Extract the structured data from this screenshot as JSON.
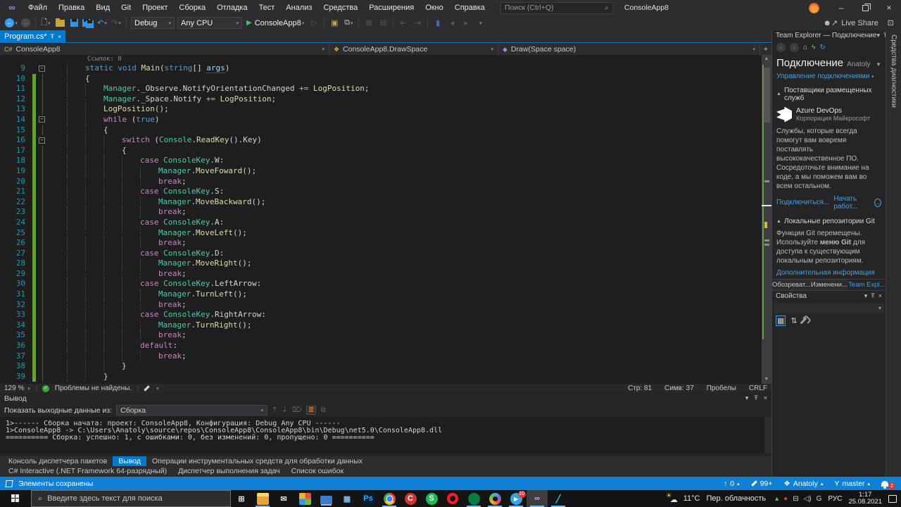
{
  "window": {
    "app_title": "ConsoleApp8",
    "search_placeholder": "Поиск (Ctrl+Q)",
    "live_share": "Live Share"
  },
  "menu": {
    "items": [
      "Файл",
      "Правка",
      "Вид",
      "Git",
      "Проект",
      "Сборка",
      "Отладка",
      "Тест",
      "Анализ",
      "Средства",
      "Расширения",
      "Окно",
      "Справка"
    ]
  },
  "toolbar": {
    "config": "Debug",
    "platform": "Any CPU",
    "start": "ConsoleApp8"
  },
  "editor": {
    "tab": "Program.cs*",
    "breadcrumb": {
      "project": "ConsoleApp8",
      "type": "ConsoleApp8.DrawSpace",
      "member": "Draw(Space space)"
    },
    "codelens": "Ссылок: 0",
    "zoom": "129 %",
    "problems": "Проблемы не найдены.",
    "status": {
      "line": "Стр: 81",
      "col": "Симв: 37",
      "spaces": "Пробелы",
      "eol": "CRLF"
    },
    "lines": [
      {
        "n": 9,
        "i": 2,
        "f": true,
        "m": false,
        "t": [
          [
            "k",
            "static"
          ],
          [
            "pl",
            " "
          ],
          [
            "k",
            "void"
          ],
          [
            "pl",
            " "
          ],
          [
            "me",
            "Main"
          ],
          [
            "pl",
            "("
          ],
          [
            "k",
            "string"
          ],
          [
            "pl",
            "[] "
          ],
          [
            "pa",
            "args"
          ],
          [
            "pl",
            ")"
          ]
        ]
      },
      {
        "n": 10,
        "i": 2,
        "f": false,
        "m": true,
        "t": [
          [
            "pl",
            "{"
          ]
        ]
      },
      {
        "n": 11,
        "i": 3,
        "f": false,
        "m": true,
        "t": [
          [
            "ty",
            "Manager"
          ],
          [
            "pl",
            "."
          ],
          [
            "pl",
            "_Observe"
          ],
          [
            "pl",
            "."
          ],
          [
            "pl",
            "NotifyOrientationChanged"
          ],
          [
            "op",
            " += "
          ],
          [
            "me",
            "LogPosition"
          ],
          [
            "pl",
            ";"
          ]
        ]
      },
      {
        "n": 12,
        "i": 3,
        "f": false,
        "m": true,
        "t": [
          [
            "ty",
            "Manager"
          ],
          [
            "pl",
            "."
          ],
          [
            "pl",
            "_Space"
          ],
          [
            "pl",
            "."
          ],
          [
            "pl",
            "Notify"
          ],
          [
            "op",
            " += "
          ],
          [
            "me",
            "LogPosition"
          ],
          [
            "pl",
            ";"
          ]
        ]
      },
      {
        "n": 13,
        "i": 3,
        "f": false,
        "m": true,
        "t": [
          [
            "me",
            "LogPosition"
          ],
          [
            "pl",
            "();"
          ]
        ]
      },
      {
        "n": 14,
        "i": 3,
        "f": true,
        "m": true,
        "t": [
          [
            "ct",
            "while"
          ],
          [
            "pl",
            " ("
          ],
          [
            "k",
            "true"
          ],
          [
            "pl",
            ")"
          ]
        ]
      },
      {
        "n": 15,
        "i": 3,
        "f": false,
        "m": true,
        "t": [
          [
            "pl",
            "{"
          ]
        ]
      },
      {
        "n": 16,
        "i": 4,
        "f": true,
        "m": true,
        "t": [
          [
            "ct",
            "switch"
          ],
          [
            "pl",
            " ("
          ],
          [
            "ty",
            "Console"
          ],
          [
            "pl",
            "."
          ],
          [
            "me",
            "ReadKey"
          ],
          [
            "pl",
            "()."
          ],
          [
            "pl",
            "Key"
          ],
          [
            "pl",
            ")"
          ]
        ]
      },
      {
        "n": 17,
        "i": 4,
        "f": false,
        "m": true,
        "t": [
          [
            "pl",
            "{"
          ]
        ]
      },
      {
        "n": 18,
        "i": 5,
        "f": false,
        "m": true,
        "t": [
          [
            "ct",
            "case"
          ],
          [
            "pl",
            " "
          ],
          [
            "ty",
            "ConsoleKey"
          ],
          [
            "pl",
            "."
          ],
          [
            "pl",
            "W"
          ],
          [
            "pl",
            ":"
          ]
        ]
      },
      {
        "n": 19,
        "i": 6,
        "f": false,
        "m": true,
        "t": [
          [
            "ty",
            "Manager"
          ],
          [
            "pl",
            "."
          ],
          [
            "me",
            "MoveFoward"
          ],
          [
            "pl",
            "();"
          ]
        ]
      },
      {
        "n": 20,
        "i": 6,
        "f": false,
        "m": true,
        "t": [
          [
            "ct",
            "break"
          ],
          [
            "pl",
            ";"
          ]
        ]
      },
      {
        "n": 21,
        "i": 5,
        "f": false,
        "m": true,
        "t": [
          [
            "ct",
            "case"
          ],
          [
            "pl",
            " "
          ],
          [
            "ty",
            "ConsoleKey"
          ],
          [
            "pl",
            "."
          ],
          [
            "pl",
            "S"
          ],
          [
            "pl",
            ":"
          ]
        ]
      },
      {
        "n": 22,
        "i": 6,
        "f": false,
        "m": true,
        "t": [
          [
            "ty",
            "Manager"
          ],
          [
            "pl",
            "."
          ],
          [
            "me",
            "MoveBackward"
          ],
          [
            "pl",
            "();"
          ]
        ]
      },
      {
        "n": 23,
        "i": 6,
        "f": false,
        "m": true,
        "t": [
          [
            "ct",
            "break"
          ],
          [
            "pl",
            ";"
          ]
        ]
      },
      {
        "n": 24,
        "i": 5,
        "f": false,
        "m": true,
        "t": [
          [
            "ct",
            "case"
          ],
          [
            "pl",
            " "
          ],
          [
            "ty",
            "ConsoleKey"
          ],
          [
            "pl",
            "."
          ],
          [
            "pl",
            "A"
          ],
          [
            "pl",
            ":"
          ]
        ]
      },
      {
        "n": 25,
        "i": 6,
        "f": false,
        "m": true,
        "t": [
          [
            "ty",
            "Manager"
          ],
          [
            "pl",
            "."
          ],
          [
            "me",
            "MoveLeft"
          ],
          [
            "pl",
            "();"
          ]
        ]
      },
      {
        "n": 26,
        "i": 6,
        "f": false,
        "m": true,
        "t": [
          [
            "ct",
            "break"
          ],
          [
            "pl",
            ";"
          ]
        ]
      },
      {
        "n": 27,
        "i": 5,
        "f": false,
        "m": true,
        "t": [
          [
            "ct",
            "case"
          ],
          [
            "pl",
            " "
          ],
          [
            "ty",
            "ConsoleKey"
          ],
          [
            "pl",
            "."
          ],
          [
            "pl",
            "D"
          ],
          [
            "pl",
            ":"
          ]
        ]
      },
      {
        "n": 28,
        "i": 6,
        "f": false,
        "m": true,
        "t": [
          [
            "ty",
            "Manager"
          ],
          [
            "pl",
            "."
          ],
          [
            "me",
            "MoveRight"
          ],
          [
            "pl",
            "();"
          ]
        ]
      },
      {
        "n": 29,
        "i": 6,
        "f": false,
        "m": true,
        "t": [
          [
            "ct",
            "break"
          ],
          [
            "pl",
            ";"
          ]
        ]
      },
      {
        "n": 30,
        "i": 5,
        "f": false,
        "m": true,
        "t": [
          [
            "ct",
            "case"
          ],
          [
            "pl",
            " "
          ],
          [
            "ty",
            "ConsoleKey"
          ],
          [
            "pl",
            "."
          ],
          [
            "pl",
            "LeftArrow"
          ],
          [
            "pl",
            ":"
          ]
        ]
      },
      {
        "n": 31,
        "i": 6,
        "f": false,
        "m": true,
        "t": [
          [
            "ty",
            "Manager"
          ],
          [
            "pl",
            "."
          ],
          [
            "me",
            "TurnLeft"
          ],
          [
            "pl",
            "();"
          ]
        ]
      },
      {
        "n": 32,
        "i": 6,
        "f": false,
        "m": true,
        "t": [
          [
            "ct",
            "break"
          ],
          [
            "pl",
            ";"
          ]
        ]
      },
      {
        "n": 33,
        "i": 5,
        "f": false,
        "m": true,
        "t": [
          [
            "ct",
            "case"
          ],
          [
            "pl",
            " "
          ],
          [
            "ty",
            "ConsoleKey"
          ],
          [
            "pl",
            "."
          ],
          [
            "pl",
            "RightArrow"
          ],
          [
            "pl",
            ":"
          ]
        ]
      },
      {
        "n": 34,
        "i": 6,
        "f": false,
        "m": true,
        "t": [
          [
            "ty",
            "Manager"
          ],
          [
            "pl",
            "."
          ],
          [
            "me",
            "TurnRight"
          ],
          [
            "pl",
            "();"
          ]
        ]
      },
      {
        "n": 35,
        "i": 6,
        "f": false,
        "m": true,
        "t": [
          [
            "ct",
            "break"
          ],
          [
            "pl",
            ";"
          ]
        ]
      },
      {
        "n": 36,
        "i": 5,
        "f": false,
        "m": true,
        "t": [
          [
            "ct",
            "default"
          ],
          [
            "pl",
            ":"
          ]
        ]
      },
      {
        "n": 37,
        "i": 6,
        "f": false,
        "m": true,
        "t": [
          [
            "ct",
            "break"
          ],
          [
            "pl",
            ";"
          ]
        ]
      },
      {
        "n": 38,
        "i": 4,
        "f": false,
        "m": true,
        "t": [
          [
            "pl",
            "}"
          ]
        ]
      },
      {
        "n": 39,
        "i": 3,
        "f": false,
        "m": true,
        "t": [
          [
            "pl",
            "}"
          ]
        ]
      }
    ]
  },
  "team_explorer": {
    "title": "Team Explorer — Подключение",
    "header": "Подключение",
    "user": "Anatoly",
    "manage_link": "Управление подключениями",
    "providers_section": "Поставщики размещенных служб",
    "azure": {
      "name": "Azure DevOps",
      "vendor": "Корпорация Майкрософт",
      "desc": "Службы, которые всегда помогут вам вовремя поставлять высококачественное ПО. Сосредоточьте внимание на коде, а мы поможем вам во всем остальном.",
      "connect_link": "Подключиться...",
      "start_link": "Начать работ..."
    },
    "git_section": "Локальные репозитории Git",
    "git_desc_1": "Функции Git перемещены. Используйте ",
    "git_desc_bold": "меню Git",
    "git_desc_2": " для доступа к существующим локальным репозиториям.",
    "git_link": "Дополнительная информация",
    "tabs": [
      {
        "label": "Обозреват...",
        "active": false
      },
      {
        "label": "Изменени...",
        "active": false
      },
      {
        "label": "Team Expl...",
        "active": true
      }
    ]
  },
  "properties_panel": {
    "title": "Свойства"
  },
  "right_strip": {
    "label": "Средства диагностики"
  },
  "output": {
    "title": "Вывод",
    "source_label": "Показать выходные данные из:",
    "source_value": "Сборка",
    "lines": [
      "1>------ Сборка начата: проект: ConsoleApp8, Конфигурация: Debug Any CPU ------",
      "1>ConsoleApp8 -> C:\\Users\\Anatoly\\source\\repos\\ConsoleApp8\\ConsoleApp8\\bin\\Debug\\net5.0\\ConsoleApp8.dll",
      "========== Сборка: успешно: 1, с ошибками: 0, без изменений: 0, пропущено: 0 =========="
    ]
  },
  "bottom_tabs": {
    "row1": [
      {
        "label": "Консоль диспетчера пакетов",
        "active": false
      },
      {
        "label": "Вывод",
        "active": true
      },
      {
        "label": "Операции инструментальных средств для обработки данных",
        "active": false
      }
    ],
    "row2": [
      {
        "label": "C# Interactive (.NET Framework 64-разрядный)",
        "active": false
      },
      {
        "label": "Диспетчер выполнения задач",
        "active": false
      },
      {
        "label": "Список ошибок",
        "active": false
      }
    ]
  },
  "status_bar": {
    "message": "Элементы сохранены",
    "pushes": "0",
    "edits": "99+",
    "user": "Anatoly",
    "branch": "master",
    "notifications": "2"
  },
  "taskbar": {
    "search_placeholder": "Введите здесь текст для поиска",
    "apps": [
      {
        "id": "task-view-button",
        "glyph": "⊞",
        "fg": "#e0e0e0",
        "shape": "none",
        "active": false
      },
      {
        "id": "file-explorer",
        "glyph": "",
        "shape": "folder",
        "active": true
      },
      {
        "id": "mail-app",
        "glyph": "✉",
        "fg": "#d8d8d8",
        "shape": "none",
        "active": false
      },
      {
        "id": "photos-app",
        "glyph": "",
        "shape": "tiles",
        "active": false
      },
      {
        "id": "my-computer",
        "glyph": "",
        "shape": "laptop",
        "active": false
      },
      {
        "id": "calculator-app",
        "glyph": "▦",
        "fg": "#7ab8e8",
        "shape": "none",
        "active": false
      },
      {
        "id": "photoshop",
        "glyph": "Ps",
        "fg": "#31a8ff",
        "bg": "#001e36",
        "shape": "square",
        "active": false
      },
      {
        "id": "chrome-browser",
        "glyph": "",
        "shape": "chrome",
        "active": true
      },
      {
        "id": "ccleaner-app",
        "glyph": "C",
        "fg": "#ffffff",
        "bg": "#d0342c",
        "shape": "circle",
        "active": false
      },
      {
        "id": "spotify-app",
        "glyph": "S",
        "fg": "#ffffff",
        "bg": "#1db954",
        "shape": "circle",
        "active": false
      },
      {
        "id": "opera-browser",
        "glyph": "",
        "shape": "ring",
        "active": false
      },
      {
        "id": "green-messenger-app",
        "glyph": "",
        "fg": "#ffffff",
        "bg": "#0d7a43",
        "shape": "circle",
        "active": true
      },
      {
        "id": "edge-browser",
        "glyph": "",
        "shape": "wheel",
        "active": true
      },
      {
        "id": "telegram-app",
        "glyph": "▸",
        "fg": "#ffffff",
        "bg": "#2fa6e0",
        "shape": "circle",
        "badge": "10",
        "active": true
      },
      {
        "id": "visual-studio",
        "glyph": "∞",
        "fg": "#c9a6f0",
        "shape": "none",
        "active": true,
        "focused": true
      },
      {
        "id": "pen-app",
        "glyph": "╱",
        "fg": "#35c7d8",
        "shape": "none",
        "active": true
      }
    ],
    "tray": {
      "temp": "11°C",
      "weather": "Пер. облачность",
      "icons": [
        {
          "id": "tray-update-icon",
          "glyph": "▴",
          "fg": "#7ec14b"
        },
        {
          "id": "tray-app-icon",
          "glyph": "●",
          "fg": "#d04038"
        },
        {
          "id": "network-icon",
          "glyph": "⊟",
          "fg": "#d8d8d8"
        },
        {
          "id": "volume-icon",
          "glyph": "◁)",
          "fg": "#d8d8d8"
        },
        {
          "id": "geforce-icon",
          "glyph": "G",
          "fg": "#d8d8d8"
        }
      ],
      "lang": "РУС",
      "time": "1:17",
      "date": "25.08.2021"
    }
  },
  "colors": {
    "accent": "#007acc",
    "statusbar": "#1080d4",
    "change_bar": "#62a03f",
    "keyword": "#569cd6",
    "control_keyword": "#c586c0",
    "type": "#4ec9b0",
    "method": "#dcdcaa",
    "link": "#4aa0e0"
  }
}
